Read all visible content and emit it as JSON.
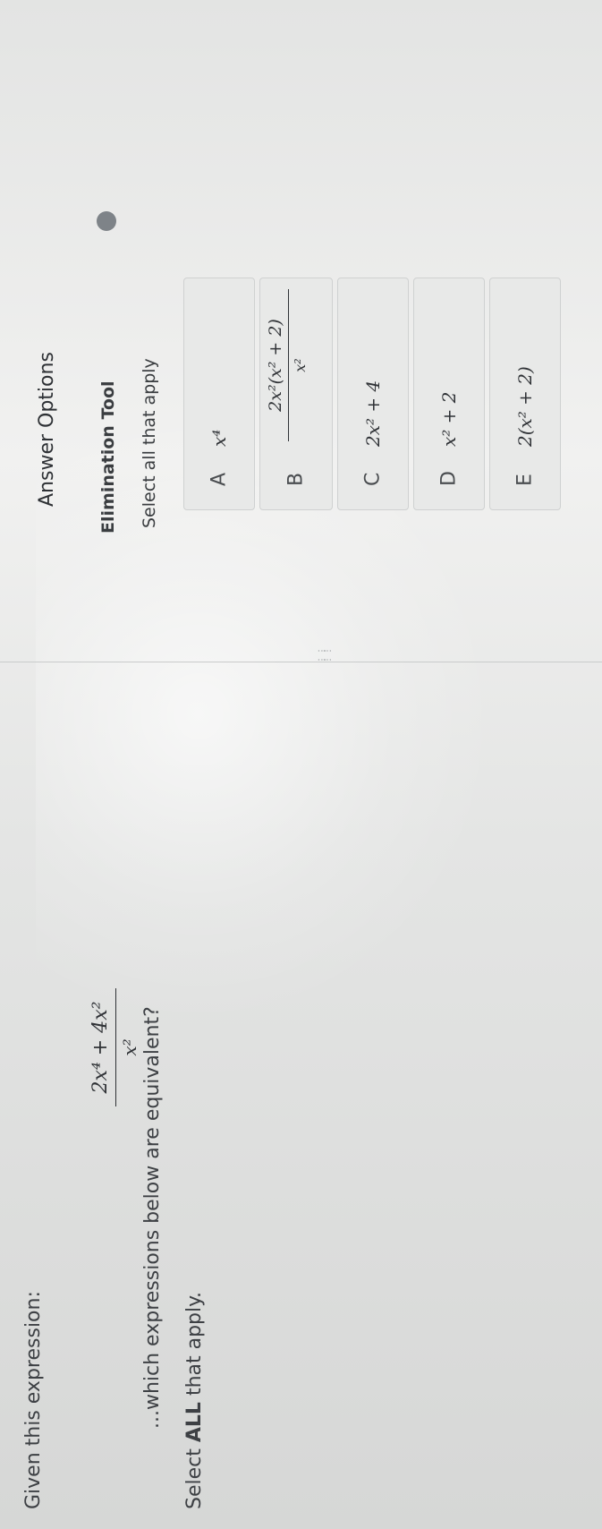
{
  "question": {
    "intro": "Given this expression:",
    "expression": {
      "numerator": "2x⁴ + 4x²",
      "denominator": "x²"
    },
    "text": "...which expressions below are equivalent?",
    "instruction_prefix": "Select ",
    "instruction_emphasis": "ALL",
    "instruction_suffix": " that apply."
  },
  "answers": {
    "title": "Answer Options",
    "elimination_tool_label": "Elimination Tool",
    "select_all_label": "Select all that apply",
    "options": [
      {
        "letter": "A",
        "expression": "x⁴"
      },
      {
        "letter": "B",
        "numerator": "2x²(x² + 2)",
        "denominator": "x²"
      },
      {
        "letter": "C",
        "expression": "2x² + 4"
      },
      {
        "letter": "D",
        "expression": "x² + 2"
      },
      {
        "letter": "E",
        "expression": "2(x² + 2)"
      }
    ]
  },
  "colors": {
    "background": "#e4e5e4",
    "text": "#3a3d40",
    "option_bg": "#e8e9e8",
    "toggle": "#7e8388"
  }
}
